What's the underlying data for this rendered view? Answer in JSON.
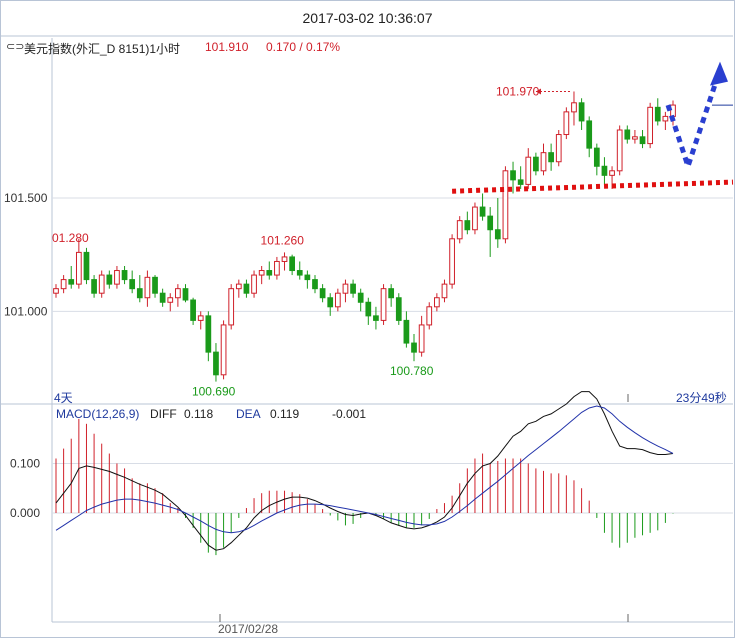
{
  "header": {
    "timestamp": "2017-03-02 10:36:07",
    "symbol_icon": "link-icon",
    "symbol_label": "美元指数(外汇_D 8151)1小时",
    "last_price": "101.910",
    "change": "0.170 / 0.17%"
  },
  "period_label": "4天",
  "countdown": "23分49秒",
  "date_label": "2017/02/28",
  "macd_header": {
    "name": "MACD(12,26,9)",
    "diff_label": "DIFF",
    "diff_value": "0.118",
    "dea_label": "DEA",
    "dea_value": "0.119",
    "hist_value": "-0.001"
  },
  "colors": {
    "up": "#d0202a",
    "down": "#1a9a1a",
    "dea_line": "#2233aa",
    "diff_line": "#111111",
    "support_line": "#e01010",
    "arrow": "#2a3fd0",
    "grid": "#d8dde6",
    "axis": "#b8c4d6"
  },
  "chart_data": [
    {
      "type": "candlestick",
      "title": "",
      "x_unit": "bar (1 hour)",
      "ylim": [
        100.6,
        102.1
      ],
      "yticks": [
        {
          "value": 101.5,
          "label": "101.500"
        },
        {
          "value": 101.0,
          "label": "101.000"
        }
      ],
      "ohlc": [
        [
          101.08,
          101.12,
          101.06,
          101.1
        ],
        [
          101.1,
          101.16,
          101.08,
          101.14
        ],
        [
          101.14,
          101.2,
          101.1,
          101.12
        ],
        [
          101.12,
          101.32,
          101.1,
          101.26
        ],
        [
          101.26,
          101.28,
          101.12,
          101.14
        ],
        [
          101.14,
          101.16,
          101.06,
          101.08
        ],
        [
          101.08,
          101.18,
          101.06,
          101.16
        ],
        [
          101.16,
          101.18,
          101.1,
          101.12
        ],
        [
          101.12,
          101.2,
          101.1,
          101.18
        ],
        [
          101.18,
          101.2,
          101.12,
          101.14
        ],
        [
          101.14,
          101.18,
          101.08,
          101.1
        ],
        [
          101.1,
          101.16,
          101.04,
          101.06
        ],
        [
          101.06,
          101.18,
          101.02,
          101.15
        ],
        [
          101.15,
          101.16,
          101.06,
          101.08
        ],
        [
          101.08,
          101.1,
          101.02,
          101.04
        ],
        [
          101.04,
          101.08,
          101.0,
          101.06
        ],
        [
          101.06,
          101.12,
          101.02,
          101.1
        ],
        [
          101.1,
          101.12,
          101.04,
          101.05
        ],
        [
          101.05,
          101.06,
          100.94,
          100.96
        ],
        [
          100.96,
          101.0,
          100.92,
          100.98
        ],
        [
          100.98,
          101.0,
          100.78,
          100.82
        ],
        [
          100.82,
          100.86,
          100.69,
          100.72
        ],
        [
          100.72,
          100.96,
          100.7,
          100.94
        ],
        [
          100.94,
          101.12,
          100.92,
          101.1
        ],
        [
          101.1,
          101.14,
          101.06,
          101.12
        ],
        [
          101.12,
          101.14,
          101.06,
          101.08
        ],
        [
          101.08,
          101.18,
          101.06,
          101.16
        ],
        [
          101.16,
          101.2,
          101.12,
          101.18
        ],
        [
          101.18,
          101.22,
          101.14,
          101.16
        ],
        [
          101.16,
          101.24,
          101.14,
          101.22
        ],
        [
          101.22,
          101.26,
          101.18,
          101.24
        ],
        [
          101.24,
          101.25,
          101.16,
          101.18
        ],
        [
          101.18,
          101.22,
          101.14,
          101.16
        ],
        [
          101.16,
          101.18,
          101.1,
          101.14
        ],
        [
          101.14,
          101.16,
          101.08,
          101.1
        ],
        [
          101.1,
          101.12,
          101.04,
          101.06
        ],
        [
          101.06,
          101.08,
          100.98,
          101.02
        ],
        [
          101.02,
          101.1,
          101.0,
          101.08
        ],
        [
          101.08,
          101.14,
          101.04,
          101.12
        ],
        [
          101.12,
          101.14,
          101.06,
          101.08
        ],
        [
          101.08,
          101.1,
          101.0,
          101.04
        ],
        [
          101.04,
          101.06,
          100.94,
          100.98
        ],
        [
          100.98,
          101.02,
          100.92,
          100.96
        ],
        [
          100.96,
          101.12,
          100.94,
          101.1
        ],
        [
          101.1,
          101.12,
          101.02,
          101.06
        ],
        [
          101.06,
          101.08,
          100.94,
          100.96
        ],
        [
          100.96,
          101.0,
          100.84,
          100.86
        ],
        [
          100.86,
          100.9,
          100.78,
          100.82
        ],
        [
          100.82,
          100.98,
          100.8,
          100.94
        ],
        [
          100.94,
          101.04,
          100.92,
          101.02
        ],
        [
          101.02,
          101.08,
          101.0,
          101.06
        ],
        [
          101.06,
          101.14,
          101.04,
          101.12
        ],
        [
          101.12,
          101.34,
          101.1,
          101.32
        ],
        [
          101.32,
          101.42,
          101.3,
          101.4
        ],
        [
          101.4,
          101.44,
          101.34,
          101.36
        ],
        [
          101.36,
          101.48,
          101.34,
          101.46
        ],
        [
          101.46,
          101.52,
          101.4,
          101.42
        ],
        [
          101.42,
          101.46,
          101.24,
          101.36
        ],
        [
          101.36,
          101.5,
          101.28,
          101.32
        ],
        [
          101.32,
          101.64,
          101.3,
          101.62
        ],
        [
          101.62,
          101.66,
          101.52,
          101.58
        ],
        [
          101.58,
          101.64,
          101.54,
          101.56
        ],
        [
          101.56,
          101.72,
          101.54,
          101.68
        ],
        [
          101.68,
          101.7,
          101.6,
          101.62
        ],
        [
          101.62,
          101.74,
          101.6,
          101.7
        ],
        [
          101.7,
          101.74,
          101.62,
          101.66
        ],
        [
          101.66,
          101.8,
          101.64,
          101.78
        ],
        [
          101.78,
          101.9,
          101.76,
          101.88
        ],
        [
          101.88,
          101.97,
          101.82,
          101.92
        ],
        [
          101.92,
          101.94,
          101.8,
          101.84
        ],
        [
          101.84,
          101.86,
          101.68,
          101.72
        ],
        [
          101.72,
          101.74,
          101.6,
          101.64
        ],
        [
          101.64,
          101.68,
          101.56,
          101.6
        ],
        [
          101.6,
          101.64,
          101.54,
          101.62
        ],
        [
          101.62,
          101.82,
          101.6,
          101.8
        ],
        [
          101.8,
          101.82,
          101.74,
          101.76
        ],
        [
          101.76,
          101.8,
          101.74,
          101.77
        ],
        [
          101.77,
          101.8,
          101.72,
          101.74
        ],
        [
          101.74,
          101.92,
          101.72,
          101.9
        ],
        [
          101.9,
          101.94,
          101.82,
          101.84
        ],
        [
          101.84,
          101.88,
          101.8,
          101.86
        ],
        [
          101.86,
          101.93,
          101.82,
          101.91
        ]
      ],
      "annotations": [
        {
          "label": "01.280",
          "value": 101.28,
          "bar": 3,
          "position": "above-left"
        },
        {
          "label": "101.260",
          "value": 101.26,
          "bar": 30,
          "position": "above"
        },
        {
          "label": "100.690",
          "value": 100.69,
          "bar": 21,
          "position": "below"
        },
        {
          "label": "100.780",
          "value": 100.78,
          "bar": 47,
          "position": "below"
        },
        {
          "label": "101.970",
          "value": 101.97,
          "bar": 68,
          "position": "left-arrow"
        }
      ],
      "support_line": {
        "style": "dotted",
        "from": {
          "bar": 52,
          "value": 101.53
        },
        "to": {
          "bar": 84,
          "value": 101.56
        }
      },
      "forecast_arrow": {
        "style": "dotted",
        "path_values": [
          101.91,
          101.64,
          102.04
        ]
      }
    },
    {
      "type": "line",
      "title": "",
      "ylim": [
        -0.22,
        0.22
      ],
      "yticks": [
        {
          "value": 0.1,
          "label": "0.100"
        },
        {
          "value": 0.0,
          "label": "0.000"
        }
      ],
      "series": [
        {
          "name": "DIFF",
          "values": [
            0.02,
            0.04,
            0.06,
            0.09,
            0.095,
            0.092,
            0.088,
            0.084,
            0.078,
            0.072,
            0.065,
            0.058,
            0.052,
            0.046,
            0.038,
            0.025,
            0.012,
            -0.005,
            -0.025,
            -0.045,
            -0.065,
            -0.075,
            -0.072,
            -0.06,
            -0.045,
            -0.03,
            -0.01,
            0.005,
            0.015,
            0.022,
            0.028,
            0.032,
            0.032,
            0.03,
            0.025,
            0.018,
            0.01,
            0.003,
            -0.003,
            -0.005,
            -0.002,
            0.0,
            -0.005,
            -0.012,
            -0.02,
            -0.025,
            -0.03,
            -0.032,
            -0.03,
            -0.025,
            -0.018,
            -0.008,
            0.01,
            0.035,
            0.06,
            0.08,
            0.095,
            0.1,
            0.115,
            0.135,
            0.155,
            0.165,
            0.18,
            0.185,
            0.195,
            0.2,
            0.21,
            0.22,
            0.235,
            0.245,
            0.245,
            0.23,
            0.2,
            0.165,
            0.135,
            0.13,
            0.13,
            0.128,
            0.122,
            0.118,
            0.118,
            0.12
          ]
        },
        {
          "name": "DEA",
          "values": [
            -0.035,
            -0.025,
            -0.015,
            -0.005,
            0.005,
            0.012,
            0.018,
            0.022,
            0.026,
            0.028,
            0.028,
            0.026,
            0.023,
            0.02,
            0.016,
            0.012,
            0.007,
            0.0,
            -0.008,
            -0.016,
            -0.025,
            -0.033,
            -0.038,
            -0.04,
            -0.038,
            -0.033,
            -0.025,
            -0.016,
            -0.008,
            0.0,
            0.006,
            0.012,
            0.016,
            0.018,
            0.018,
            0.017,
            0.015,
            0.012,
            0.009,
            0.006,
            0.003,
            0.0,
            -0.003,
            -0.007,
            -0.011,
            -0.015,
            -0.019,
            -0.022,
            -0.024,
            -0.024,
            -0.022,
            -0.017,
            -0.008,
            0.003,
            0.015,
            0.028,
            0.04,
            0.052,
            0.064,
            0.077,
            0.09,
            0.103,
            0.116,
            0.128,
            0.14,
            0.152,
            0.164,
            0.177,
            0.19,
            0.203,
            0.212,
            0.216,
            0.212,
            0.2,
            0.185,
            0.173,
            0.162,
            0.152,
            0.143,
            0.135,
            0.128,
            0.12
          ]
        }
      ],
      "histogram": {
        "name": "MACD",
        "values": [
          0.11,
          0.13,
          0.15,
          0.19,
          0.18,
          0.16,
          0.14,
          0.12,
          0.1,
          0.09,
          0.07,
          0.06,
          0.06,
          0.05,
          0.04,
          0.02,
          0.01,
          -0.01,
          -0.03,
          -0.06,
          -0.08,
          -0.085,
          -0.07,
          -0.04,
          -0.01,
          0.01,
          0.03,
          0.04,
          0.045,
          0.045,
          0.045,
          0.042,
          0.038,
          0.028,
          0.018,
          0.008,
          -0.005,
          -0.015,
          -0.025,
          -0.022,
          -0.01,
          0.0,
          -0.005,
          -0.012,
          -0.02,
          -0.026,
          -0.03,
          -0.03,
          -0.025,
          -0.012,
          0.008,
          0.02,
          0.035,
          0.06,
          0.09,
          0.11,
          0.12,
          0.1,
          0.105,
          0.11,
          0.11,
          0.11,
          0.1,
          0.09,
          0.085,
          0.08,
          0.08,
          0.076,
          0.066,
          0.05,
          0.025,
          -0.01,
          -0.04,
          -0.06,
          -0.07,
          -0.06,
          -0.05,
          -0.045,
          -0.04,
          -0.035,
          -0.02,
          -0.001
        ]
      }
    }
  ]
}
